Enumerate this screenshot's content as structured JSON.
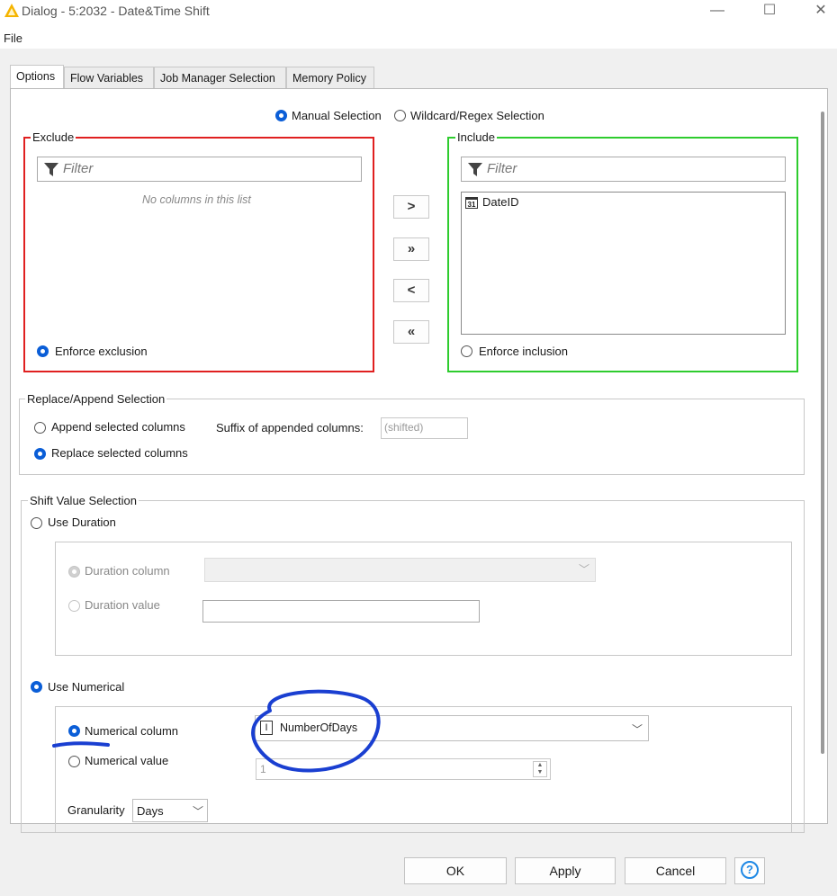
{
  "window": {
    "title": "Dialog - 5:2032 - Date&Time Shift",
    "minimize": "—",
    "maximize": "☐",
    "close": "✕"
  },
  "menu": {
    "file": "File"
  },
  "tabs": [
    "Options",
    "Flow Variables",
    "Job Manager Selection",
    "Memory Policy"
  ],
  "column_filter": {
    "mode_manual": "Manual Selection",
    "mode_wildcard": "Wildcard/Regex Selection",
    "exclude": {
      "title": "Exclude",
      "filter_placeholder": "Filter",
      "empty_text": "No columns in this list",
      "enforce": "Enforce exclusion"
    },
    "include": {
      "title": "Include",
      "filter_placeholder": "Filter",
      "items": [
        {
          "icon": "31",
          "label": "DateID"
        }
      ],
      "enforce": "Enforce inclusion"
    },
    "move_buttons": [
      ">",
      "»",
      "<",
      "«"
    ]
  },
  "replace_append": {
    "title": "Replace/Append Selection",
    "append": "Append selected columns",
    "replace": "Replace selected columns",
    "suffix_label": "Suffix of appended columns:",
    "suffix_value": "(shifted)"
  },
  "shift_value": {
    "title": "Shift Value Selection",
    "use_duration": "Use Duration",
    "duration_column": "Duration column",
    "duration_value": "Duration value",
    "use_numerical": "Use Numerical",
    "numerical_column": "Numerical column",
    "numerical_column_value": "NumberOfDays",
    "numerical_column_icon": "I",
    "numerical_value": "Numerical value",
    "numerical_value_value": "1",
    "granularity_label": "Granularity",
    "granularity_value": "Days"
  },
  "buttons": {
    "ok": "OK",
    "apply": "Apply",
    "cancel": "Cancel",
    "help": "?"
  },
  "colors": {
    "exclude_border": "#e02020",
    "include_border": "#2ecc2e",
    "radio_on": "#0b5ed7",
    "annotation_ink": "#1a3fd1"
  }
}
